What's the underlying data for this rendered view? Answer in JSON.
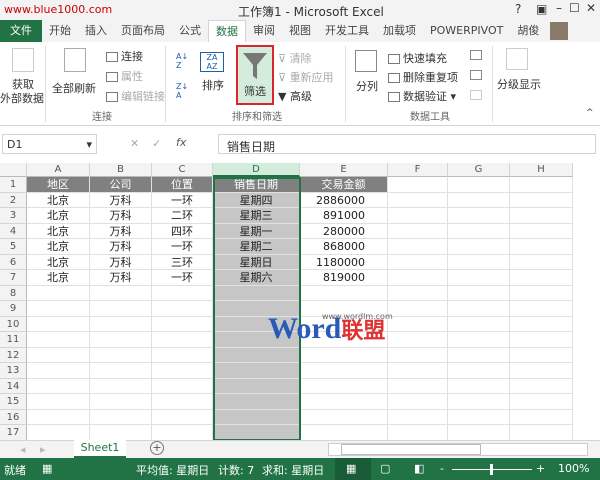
{
  "title": "工作簿1 - Microsoft Excel",
  "watermark_url": "www.blue1000.com",
  "window_controls": [
    "?",
    "□",
    "–",
    "☐",
    "✕"
  ],
  "tabs": [
    "文件",
    "开始",
    "插入",
    "页面布局",
    "公式",
    "数据",
    "审阅",
    "视图",
    "开发工具",
    "加载项",
    "POWERPIVOT"
  ],
  "user": "胡俊",
  "ribbon": {
    "get_external_1": "获取",
    "get_external_2": "外部数据",
    "refresh_all": "全部刷新",
    "connections": "连接",
    "properties": "属性",
    "edit_links": "编辑链接",
    "group_connections": "连接",
    "sort": "排序",
    "filter": "筛选",
    "clear": "清除",
    "reapply": "重新应用",
    "advanced": "高级",
    "group_sort": "排序和筛选",
    "text_to_columns": "分列",
    "flash_fill": "快速填充",
    "remove_duplicates": "删除重复项",
    "data_validation": "数据验证",
    "group_tools": "数据工具",
    "outline": "分级显示"
  },
  "formula": {
    "name_box": "D1",
    "content": "销售日期",
    "fx": "fx"
  },
  "columns": [
    "A",
    "B",
    "C",
    "D",
    "E",
    "F",
    "G",
    "H"
  ],
  "rows": [
    "1",
    "2",
    "3",
    "4",
    "5",
    "6",
    "7",
    "8",
    "9",
    "10",
    "11",
    "12",
    "13",
    "14",
    "15",
    "16",
    "17"
  ],
  "table": {
    "headers": [
      "地区",
      "公司",
      "位置",
      "销售日期",
      "交易金额"
    ],
    "data": [
      [
        "北京",
        "万科",
        "一环",
        "星期四",
        "2886000"
      ],
      [
        "北京",
        "万科",
        "二环",
        "星期三",
        "891000"
      ],
      [
        "北京",
        "万科",
        "四环",
        "星期一",
        "280000"
      ],
      [
        "北京",
        "万科",
        "一环",
        "星期二",
        "868000"
      ],
      [
        "北京",
        "万科",
        "三环",
        "星期日",
        "1180000"
      ],
      [
        "北京",
        "万科",
        "一环",
        "星期六",
        "819000"
      ]
    ]
  },
  "logo": {
    "word": "Word",
    "cn": "联盟",
    "url": "www.wordlm.com"
  },
  "sheet_tab": "Sheet1",
  "status": {
    "ready": "就绪",
    "average": "平均值: 星期日",
    "count": "计数: 7",
    "sum": "求和: 星期日",
    "zoom": "100%"
  },
  "colors": {
    "excel_green": "#217346",
    "header_fill": "#808080",
    "selection": "#c6c6c6",
    "filter_highlight": "#d3ecdb",
    "red_box": "#d9262c"
  }
}
